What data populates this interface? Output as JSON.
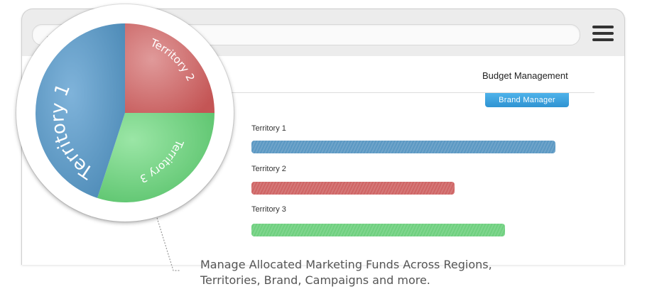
{
  "header": {
    "title": "Budget Management",
    "role_button_label": "Brand Manager"
  },
  "territories": [
    {
      "label": "Territory 1",
      "color": "#5b98c3",
      "bar_fraction": 0.995
    },
    {
      "label": "Territory 2",
      "color": "#cf6565",
      "bar_fraction": 0.665
    },
    {
      "label": "Territory 3",
      "color": "#6fd07f",
      "bar_fraction": 0.83
    }
  ],
  "pie": {
    "slices": [
      {
        "label": "Territory 1",
        "color": "#5b98c3",
        "share": 0.45
      },
      {
        "label": "Territory 2",
        "color": "#cf6565",
        "share": 0.25
      },
      {
        "label": "Territory 3",
        "color": "#6fd07f",
        "share": 0.3
      }
    ]
  },
  "caption": {
    "line1": "Manage Allocated Marketing Funds Across Regions,",
    "line2": "Territories, Brand, Campaigns and more."
  },
  "icons": [
    "back-arrow-icon",
    "hamburger-menu-icon"
  ]
}
